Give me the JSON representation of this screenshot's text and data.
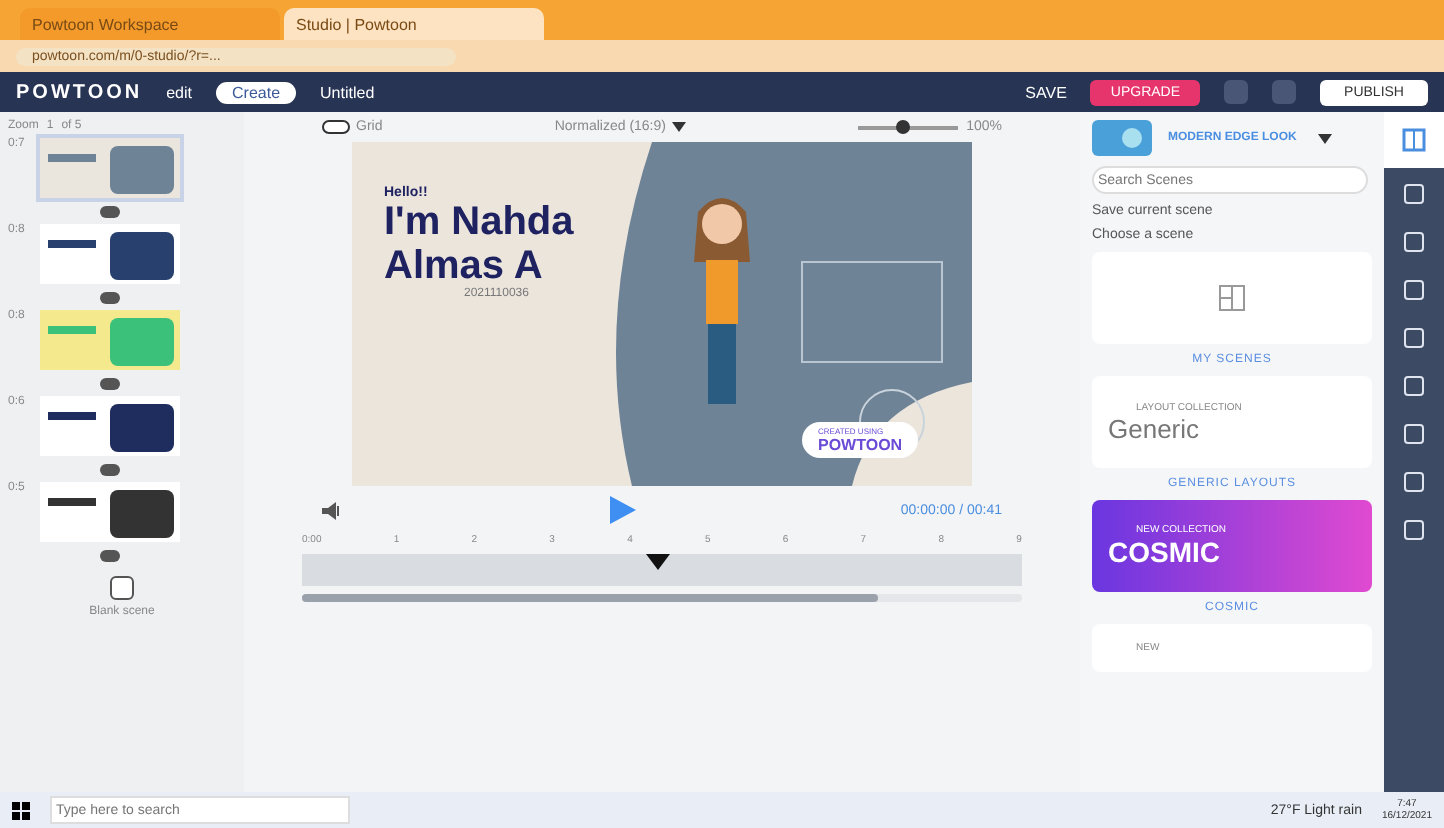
{
  "browser": {
    "tabs": [
      {
        "title": "Powtoon Workspace",
        "selected": false
      },
      {
        "title": "Studio | Powtoon",
        "selected": true
      }
    ],
    "url": "powtoon.com/m/0-studio/?r=..."
  },
  "toolbar": {
    "logo": "POWTOON",
    "mode": "edit",
    "pill": "Create",
    "title": "Untitled",
    "save": "SAVE",
    "upgrade": "UPGRADE",
    "publish": "PUBLISH"
  },
  "scenes": {
    "zoom_label": "Zoom",
    "zoom_value": "1",
    "zoom_total": "of 5",
    "items": [
      {
        "time": "0:7",
        "selected": true
      },
      {
        "time": "0:8",
        "selected": false
      },
      {
        "time": "0:8",
        "selected": false
      },
      {
        "time": "0:6",
        "selected": false
      },
      {
        "time": "0:5",
        "selected": false
      }
    ],
    "blank": "Blank scene"
  },
  "stage": {
    "grid": {
      "label": "Grid",
      "on": false
    },
    "ratio": "Normalized (16:9)",
    "zoom": "100%",
    "zoom_slider": {
      "level": 0.45
    },
    "slide": {
      "hello": "Hello!!",
      "name": "I'm Nahda Almas A",
      "id": "2021110036",
      "badge_small": "CREATED USING",
      "badge": "POWTOON"
    },
    "time": "00:00:00 / 00:41",
    "ticks": [
      "0:00",
      "1",
      "2",
      "3",
      "4",
      "5",
      "6",
      "7",
      "8",
      "9"
    ]
  },
  "library": {
    "look": "MODERN EDGE LOOK",
    "search": {
      "placeholder": "Search Scenes"
    },
    "save_scene": "Save current scene",
    "choose": "Choose a scene",
    "cards": [
      {
        "kind": "blank",
        "caption": "MY SCENES"
      },
      {
        "kind": "generic",
        "tag": "LAYOUT COLLECTION",
        "title": "Generic",
        "caption": "GENERIC LAYOUTS"
      },
      {
        "kind": "cosmic",
        "tag": "NEW COLLECTION",
        "title": "COSMIC",
        "caption": "COSMIC"
      },
      {
        "kind": "partial",
        "tag": "NEW"
      }
    ]
  },
  "taskbar": {
    "search": {
      "placeholder": "Type here to search"
    },
    "weather": "27°F Light rain",
    "time": "7:47",
    "date": "16/12/2021"
  }
}
